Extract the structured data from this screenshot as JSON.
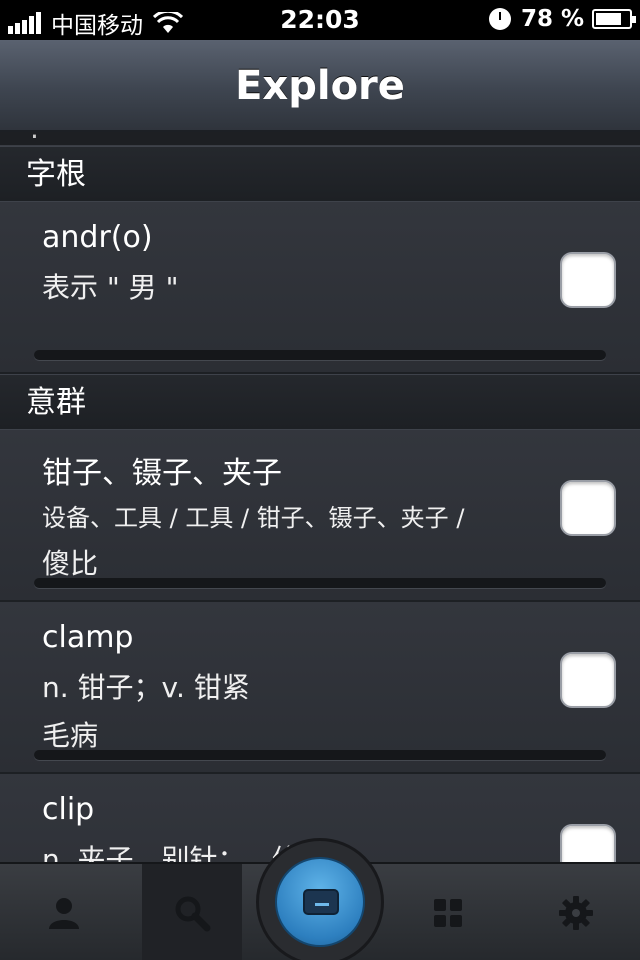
{
  "status_bar": {
    "carrier": "中国移动",
    "time": "22:03",
    "battery_percent": "78 %"
  },
  "nav": {
    "title": "Explore"
  },
  "sections": [
    {
      "header": "字根",
      "rows": [
        {
          "title": "andr(o)",
          "meaning": "表示 \" 男 \"",
          "extra": "",
          "checked": false
        }
      ]
    },
    {
      "header": "意群",
      "rows": [
        {
          "title": "钳子、镊子、夹子",
          "meaning": "设备、工具 / 工具 / 钳子、镊子、夹子 /",
          "extra": "傻比",
          "checked": false
        },
        {
          "title": "clamp",
          "meaning": "n.  钳子；v. 钳紧",
          "extra": "毛病",
          "checked": false
        },
        {
          "title": "clip",
          "meaning": "n.  夹子，别针；...修剪",
          "extra": "",
          "checked": false
        }
      ]
    }
  ],
  "tabbar": {
    "tabs": [
      "person-icon",
      "search-icon",
      "review-button",
      "grid-icon",
      "gear-icon"
    ],
    "active": "search-icon",
    "accent": "#2d7fbf"
  }
}
